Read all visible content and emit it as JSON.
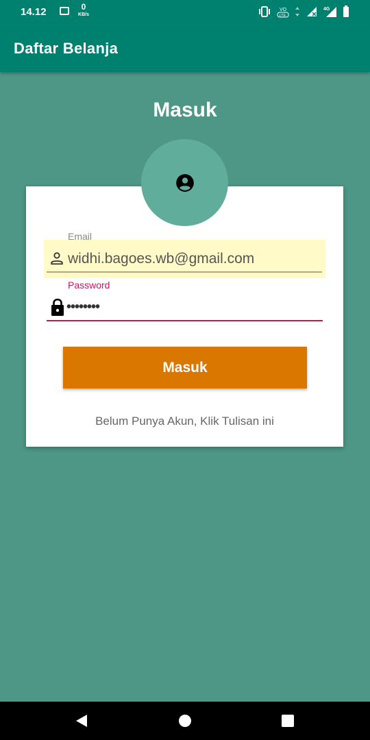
{
  "status_bar": {
    "time": "14.12",
    "net_speed_value": "0",
    "net_speed_unit": "KB/s",
    "icons": [
      "image-icon",
      "vibrate-icon",
      "volte-icon",
      "data-arrows-icon",
      "signal-icon",
      "4g-signal-icon",
      "battery-icon"
    ],
    "network_type": "4G"
  },
  "app_bar": {
    "title": "Daftar Belanja"
  },
  "page": {
    "title": "Masuk"
  },
  "avatar": {
    "icon": "account-circle-icon"
  },
  "form": {
    "email": {
      "label": "Email",
      "value": "widhi.bagoes.wb@gmail.com",
      "icon": "person-icon"
    },
    "password": {
      "label": "Password",
      "value": "••••••••",
      "icon": "lock-icon"
    },
    "submit_label": "Masuk",
    "register_text": "Belum Punya Akun, Klik Tulisan ini"
  },
  "colors": {
    "app_bar": "#00806f",
    "background": "#4e9685",
    "avatar": "#5fad9a",
    "button": "#d97700",
    "accent": "#c2185b",
    "autofill": "#fffac8"
  },
  "nav_bar": {
    "icons": [
      "back-icon",
      "home-icon",
      "recents-icon"
    ]
  }
}
